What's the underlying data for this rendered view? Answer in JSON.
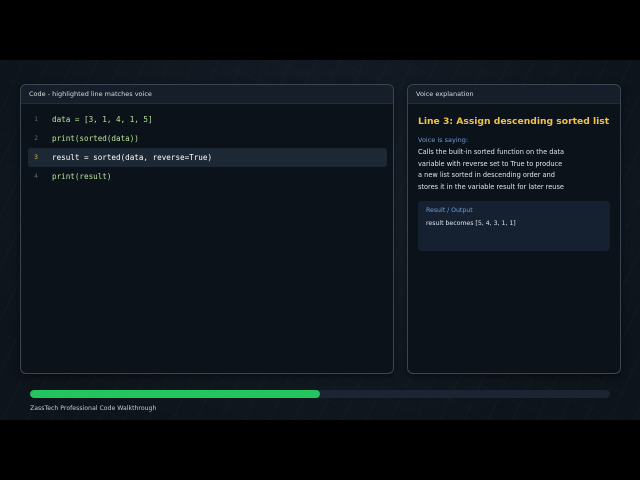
{
  "code_panel": {
    "header": "Code - highlighted line matches voice",
    "active_line": 3,
    "lines": [
      {
        "number": "1",
        "text": "data = [3, 1, 4, 1, 5]"
      },
      {
        "number": "2",
        "text": "print(sorted(data))"
      },
      {
        "number": "3",
        "text": "result = sorted(data, reverse=True)"
      },
      {
        "number": "4",
        "text": "print(result)"
      }
    ]
  },
  "voice_panel": {
    "header": "Voice explanation",
    "title": "Line 3: Assign descending sorted list",
    "saying_label": "Voice is saying:",
    "text": "Calls the built-in sorted function on the data variable with reverse set to True to produce a new list sorted in descending order and stores it in the variable result for later reuse",
    "result_label": "Result / Output",
    "result_value": "result becomes [5, 4, 3, 1, 1]"
  },
  "progress": {
    "fraction": 0.5
  },
  "footer": {
    "caption": "ZassTech Professional Code Walkthrough"
  },
  "colors": {
    "accent_title": "#f0c24e",
    "progress_fill": "#22c55e",
    "code_text": "#b9e39b",
    "label_blue": "#6e9ed8"
  }
}
